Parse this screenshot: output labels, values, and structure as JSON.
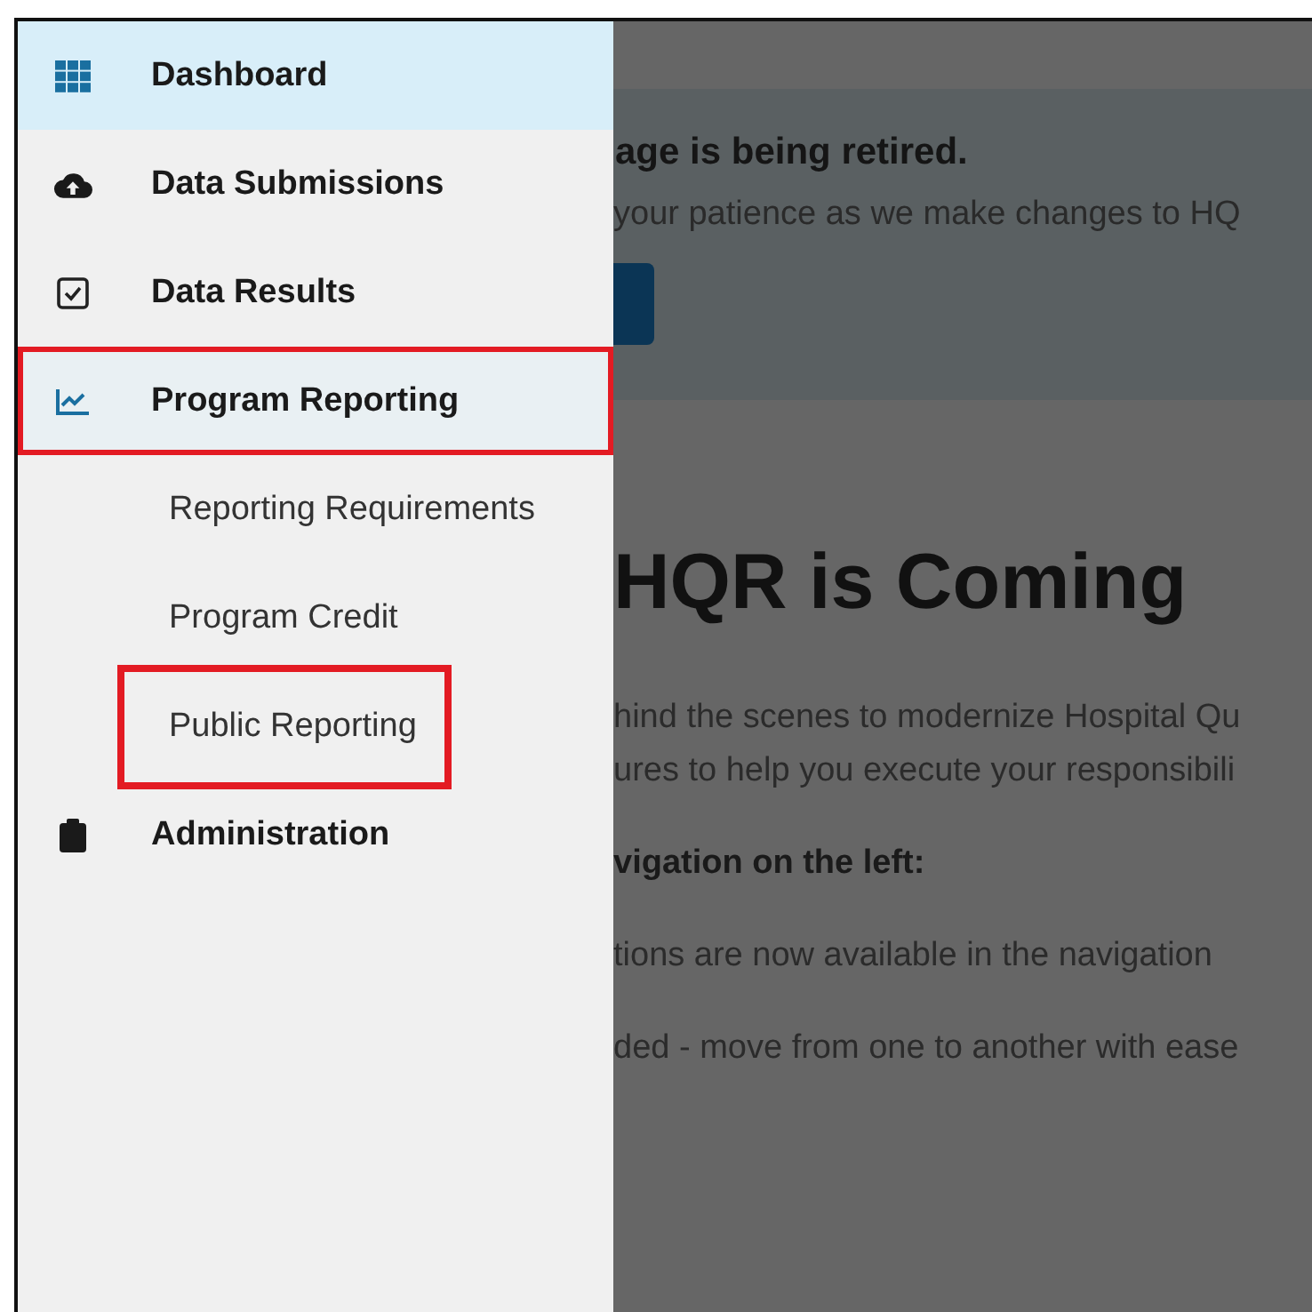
{
  "sidebar": {
    "items": [
      {
        "label": "Dashboard",
        "selected": true,
        "highlighted": false
      },
      {
        "label": "Data Submissions",
        "selected": false,
        "highlighted": false
      },
      {
        "label": "Data Results",
        "selected": false,
        "highlighted": false
      },
      {
        "label": "Program Reporting",
        "selected": false,
        "expanded": true,
        "highlighted": true,
        "children": [
          {
            "label": "Reporting Requirements",
            "highlighted": false
          },
          {
            "label": "Program Credit",
            "highlighted": false
          },
          {
            "label": "Public Reporting",
            "highlighted": true
          }
        ]
      },
      {
        "label": "Administration",
        "selected": false,
        "highlighted": false
      }
    ]
  },
  "main": {
    "banner": {
      "title": "age is being retired.",
      "text": "your patience as we make changes to HQ"
    },
    "heading": "HQR is Coming",
    "paragraphs": [
      {
        "kind": "text",
        "lines": [
          "hind the scenes to modernize Hospital Qu",
          "ures to help you execute your responsibili"
        ]
      },
      {
        "kind": "bold",
        "lines": [
          "vigation on the left:"
        ]
      },
      {
        "kind": "text",
        "lines": [
          "tions are now available in the navigation"
        ]
      },
      {
        "kind": "text",
        "lines": [
          "ded - move from one to another with ease"
        ]
      }
    ]
  }
}
